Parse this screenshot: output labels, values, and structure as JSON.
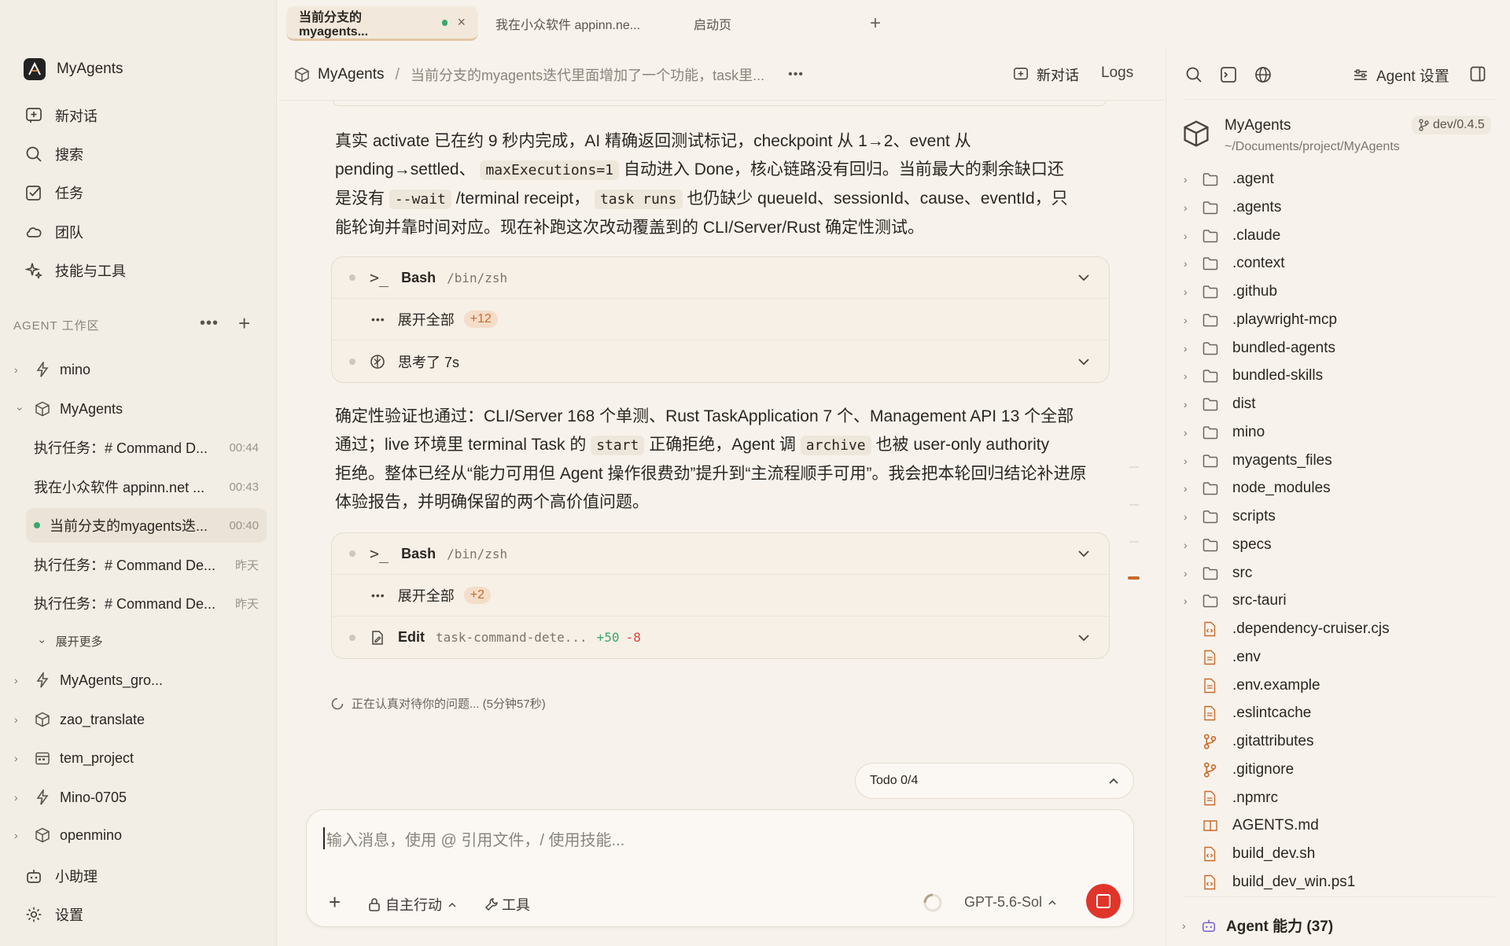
{
  "colors": {
    "accent": "#c96a2b",
    "green": "#3aa76d",
    "danger": "#e0352b"
  },
  "tabs": [
    {
      "label": "当前分支的myagents...",
      "active": true
    },
    {
      "label": "我在小众软件 appinn.ne..."
    },
    {
      "label": "启动页"
    }
  ],
  "sidebar": {
    "app_name": "MyAgents",
    "nav": [
      "新对话",
      "搜索",
      "任务",
      "团队",
      "技能与工具"
    ],
    "workspace_label": "AGENT 工作区",
    "projects_top": [
      "mino",
      "MyAgents"
    ],
    "sessions": [
      {
        "title": "执行任务：# Command D...",
        "time": "00:44"
      },
      {
        "title": "我在小众软件 appinn.net ...",
        "time": "00:43"
      },
      {
        "title": "当前分支的myagents迭...",
        "time": "00:40",
        "active": true
      },
      {
        "title": "执行任务：# Command De...",
        "time": "昨天"
      },
      {
        "title": "执行任务：# Command De...",
        "time": "昨天"
      }
    ],
    "expand_more": "展开更多",
    "projects_bottom": [
      "MyAgents_gro...",
      "zao_translate",
      "tem_project",
      "Mino-0705",
      "openmino"
    ],
    "assistant": "小助理",
    "settings": "设置"
  },
  "header": {
    "project": "MyAgents",
    "separator": "/",
    "title": "当前分支的myagents迭代里面增加了一个功能，task里...",
    "new_chat": "新对话",
    "logs": "Logs"
  },
  "messages": {
    "p1": {
      "t1": "真实 activate 已在约 9 秒内完成，AI 精确返回测试标记，checkpoint 从 1→2、event 从",
      "t2a": "pending→settled、",
      "c1": "maxExecutions=1",
      "t2b": "自动进入 Done，核心链路没有回归。当前最大的剩余缺口还",
      "t3a": "是没有",
      "c2": "--wait",
      "t3b": "/terminal receipt，",
      "c3": "task runs",
      "t3c": "也仍缺少 queueId、sessionId、cause、eventId，只",
      "t4": "能轮询并靠时间对应。现在补跑这次改动覆盖到的 CLI/Server/Rust 确定性测试。"
    },
    "card1": {
      "tool": "Bash",
      "path": "/bin/zsh",
      "expand": "展开全部",
      "count": "+12",
      "think": "思考了 7s"
    },
    "p2": {
      "t1": "确定性验证也通过：CLI/Server 168 个单测、Rust TaskApplication 7 个、Management API 13 个全部",
      "t2a": "通过；live 环境里 terminal Task 的",
      "c1": "start",
      "t2b": "正确拒绝，Agent 调",
      "c2": "archive",
      "t2c": "也被 user-only authority",
      "t3": "拒绝。整体已经从“能力可用但 Agent 操作很费劲”提升到“主流程顺手可用”。我会把本轮回归结论补进原",
      "t4": "体验报告，并明确保留的两个高价值问题。"
    },
    "card2": {
      "tool": "Bash",
      "path": "/bin/zsh",
      "expand": "展开全部",
      "count": "+2",
      "edit": "Edit",
      "file": "task-command-dete...",
      "add": "+50",
      "del": "-8"
    },
    "status": "正在认真对待你的问题... (5分钟57秒)"
  },
  "todo": {
    "label": "Todo 0/4"
  },
  "composer": {
    "placeholder": "输入消息，使用 @ 引用文件，/ 使用技能...",
    "mode": "自主行动",
    "tools": "工具",
    "model": "GPT-5.6-Sol"
  },
  "rpanel": {
    "agent_settings": "Agent 设置",
    "project": "MyAgents",
    "branch": "dev/0.4.5",
    "path": "~/Documents/project/MyAgents",
    "folders": [
      ".agent",
      ".agents",
      ".claude",
      ".context",
      ".github",
      ".playwright-mcp",
      "bundled-agents",
      "bundled-skills",
      "dist",
      "mino",
      "myagents_files",
      "node_modules",
      "scripts",
      "specs",
      "src",
      "src-tauri"
    ],
    "files": [
      {
        "name": ".dependency-cruiser.cjs",
        "icon": "code-file-icon"
      },
      {
        "name": ".env",
        "icon": "text-file-icon"
      },
      {
        "name": ".env.example",
        "icon": "text-file-icon"
      },
      {
        "name": ".eslintcache",
        "icon": "text-file-icon"
      },
      {
        "name": ".gitattributes",
        "icon": "git-file-icon"
      },
      {
        "name": ".gitignore",
        "icon": "git-file-icon"
      },
      {
        "name": ".npmrc",
        "icon": "text-file-icon"
      },
      {
        "name": "AGENTS.md",
        "icon": "book-file-icon"
      },
      {
        "name": "build_dev.sh",
        "icon": "code-file-icon"
      },
      {
        "name": "build_dev_win.ps1",
        "icon": "code-file-icon"
      }
    ],
    "capabilities": "Agent 能力 (37)"
  }
}
